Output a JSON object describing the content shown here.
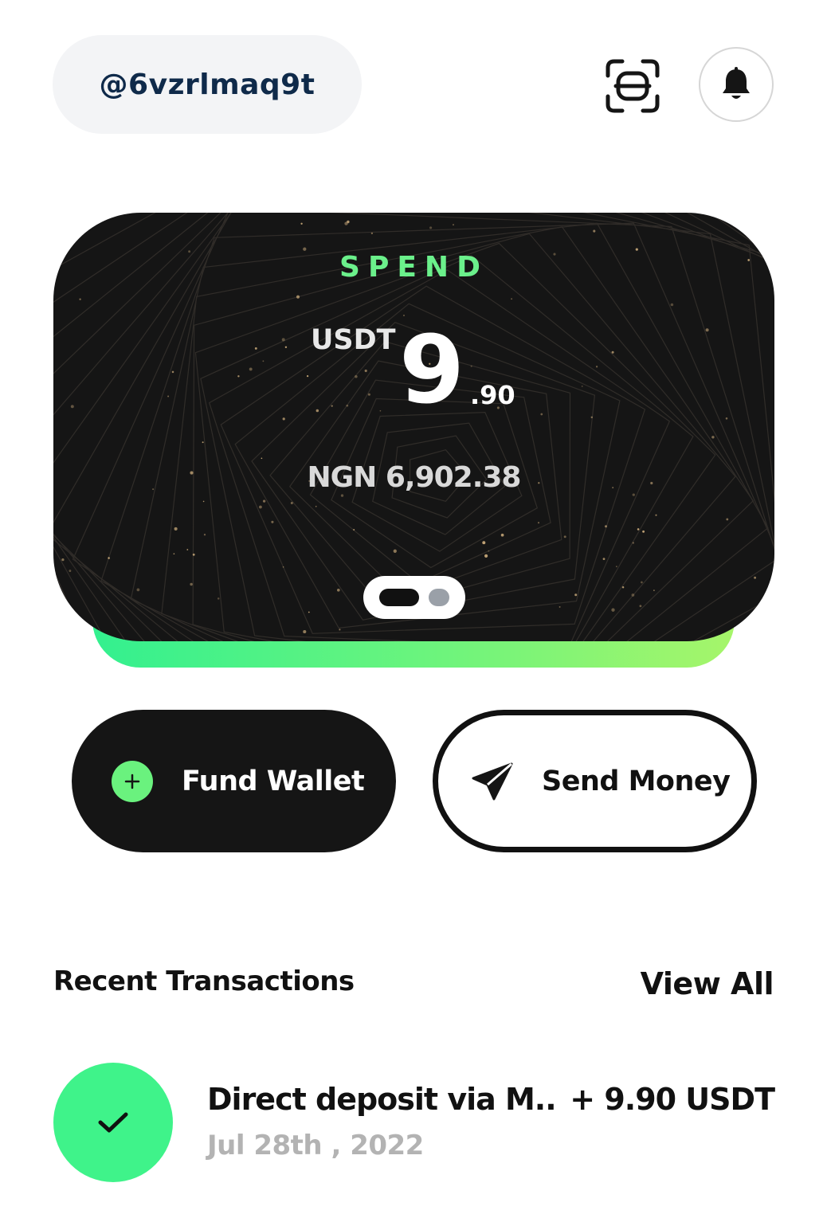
{
  "header": {
    "username": "@6vzrlmaq9t",
    "scan_icon": "scan-icon",
    "bell_icon": "bell-icon"
  },
  "balance_card": {
    "label": "SPEND",
    "currency": "USDT",
    "amount_whole": "9",
    "amount_decimal": ".90",
    "fiat_amount": "NGN 6,902.38",
    "pager": {
      "pages": 2,
      "active_index": 0
    },
    "colors": {
      "background": "#151515",
      "label": "#6bf08b",
      "glow_start": "#33f08f",
      "glow_end": "#a6f56a"
    }
  },
  "actions": {
    "fund_wallet": {
      "label": "Fund Wallet",
      "icon": "plus-icon"
    },
    "send_money": {
      "label": "Send Money",
      "icon": "send-icon"
    }
  },
  "transactions": {
    "title": "Recent Transactions",
    "view_all_label": "View All",
    "items": [
      {
        "description": "Direct deposit via M...",
        "amount": "+ 9.90 USDT",
        "date": "Jul 28th , 2022",
        "status_icon": "check-icon",
        "status_color": "#3ff38a"
      }
    ]
  }
}
